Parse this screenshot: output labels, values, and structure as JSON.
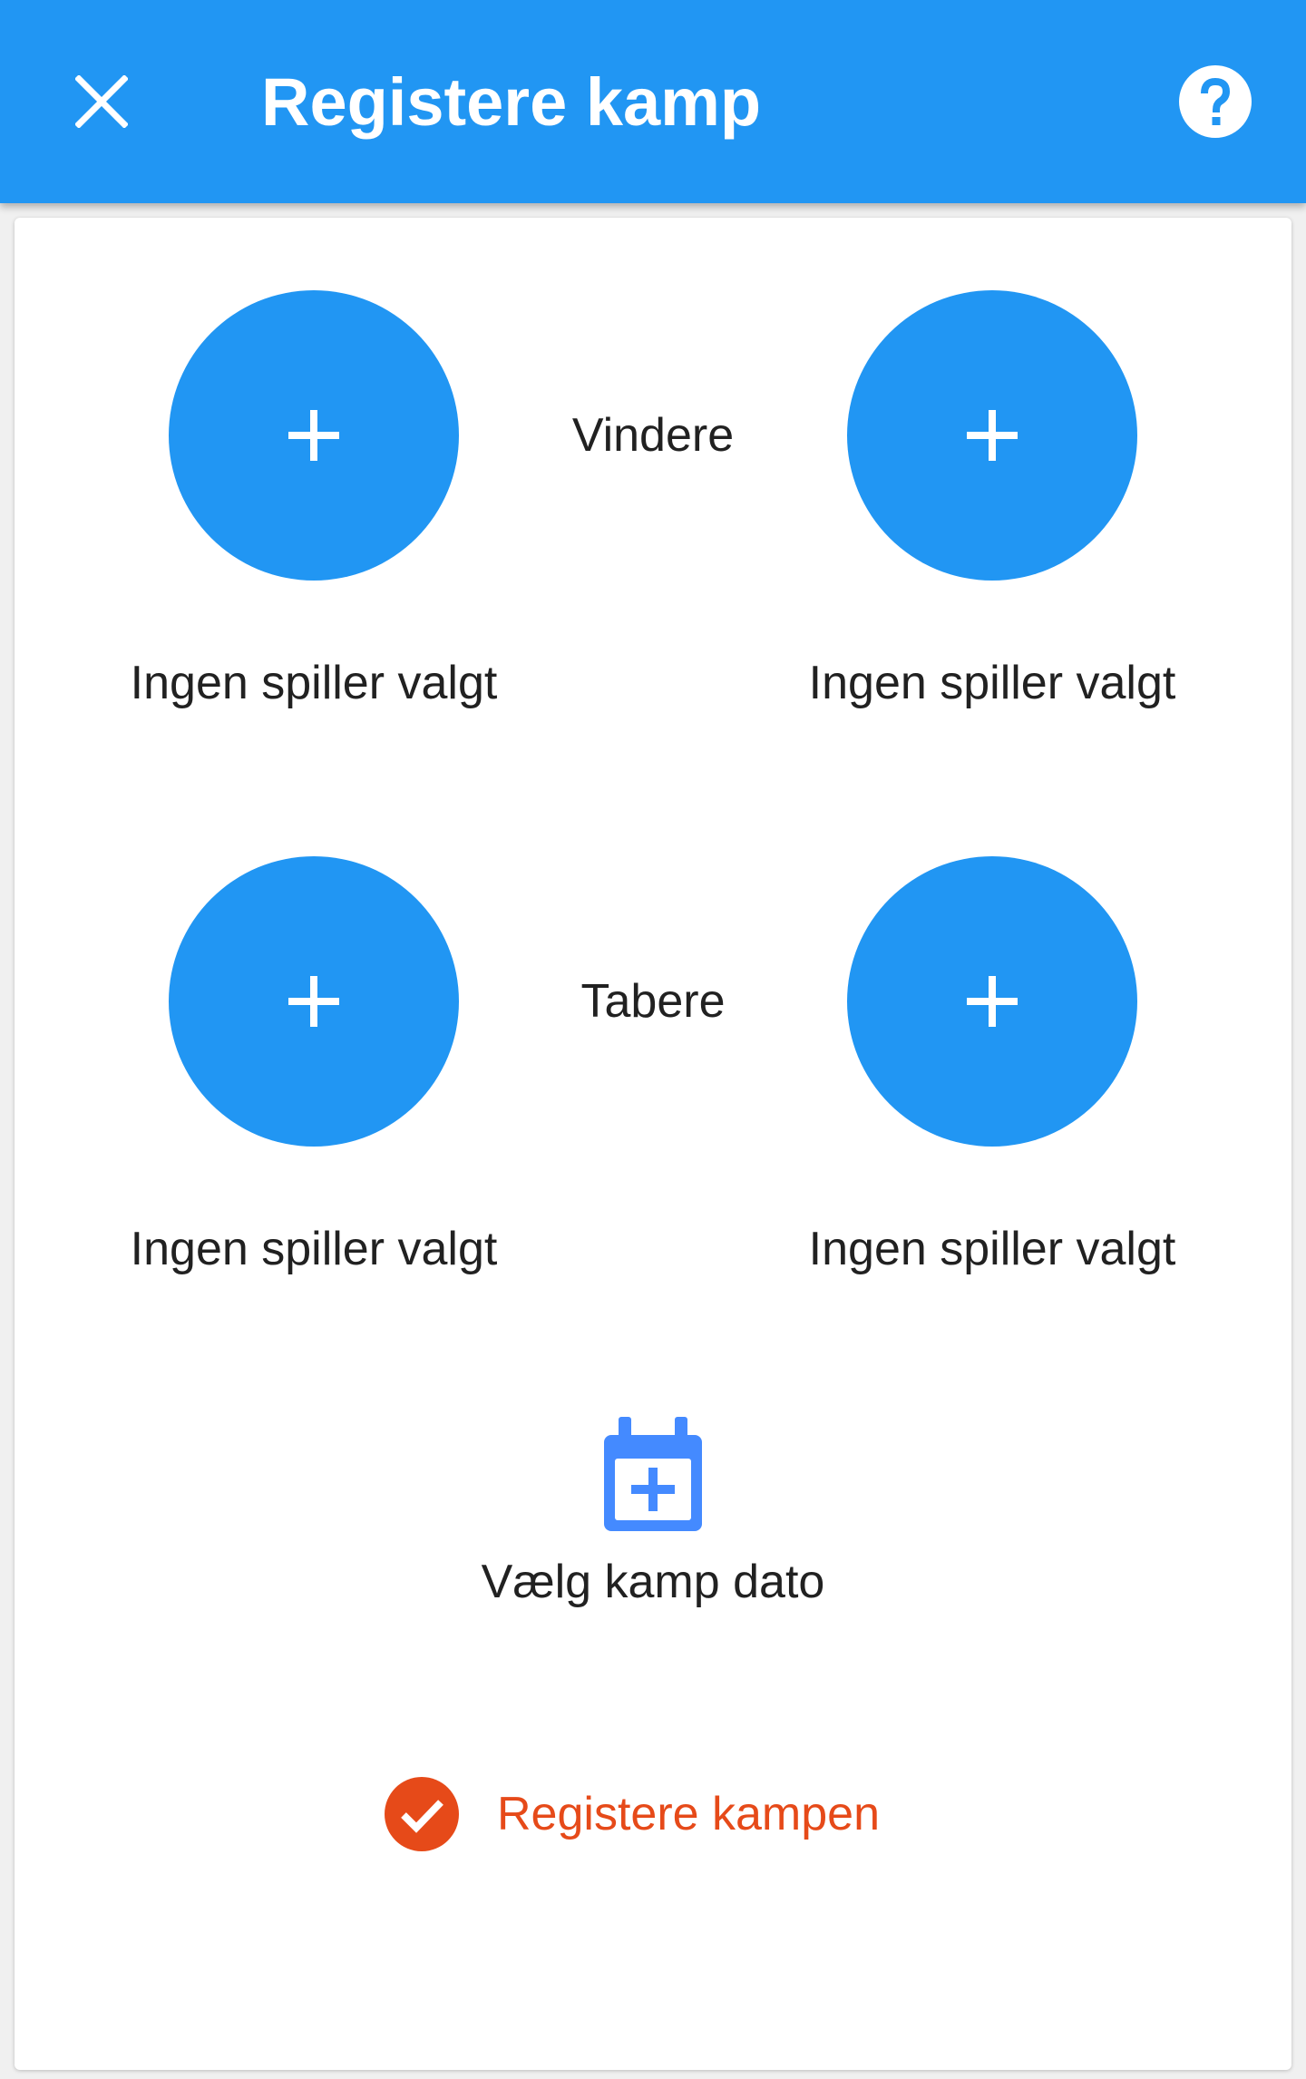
{
  "app_bar": {
    "title": "Registere kamp",
    "close_icon": "close-icon",
    "help_icon": "help-circle-icon"
  },
  "winners": {
    "label": "Vindere",
    "player_1": {
      "status": "Ingen spiller valgt",
      "icon": "plus-icon"
    },
    "player_2": {
      "status": "Ingen spiller valgt",
      "icon": "plus-icon"
    }
  },
  "losers": {
    "label": "Tabere",
    "player_1": {
      "status": "Ingen spiller valgt",
      "icon": "plus-icon"
    },
    "player_2": {
      "status": "Ingen spiller valgt",
      "icon": "plus-icon"
    }
  },
  "date_picker": {
    "label": "Vælg kamp dato",
    "icon": "calendar-plus-icon"
  },
  "submit": {
    "label": "Registere kampen",
    "icon": "check-circle-icon"
  },
  "colors": {
    "primary": "#2196F3",
    "accent": "#E64A19",
    "calendar_icon": "#448AFF",
    "text": "#212121",
    "background": "#F0F0F0"
  }
}
